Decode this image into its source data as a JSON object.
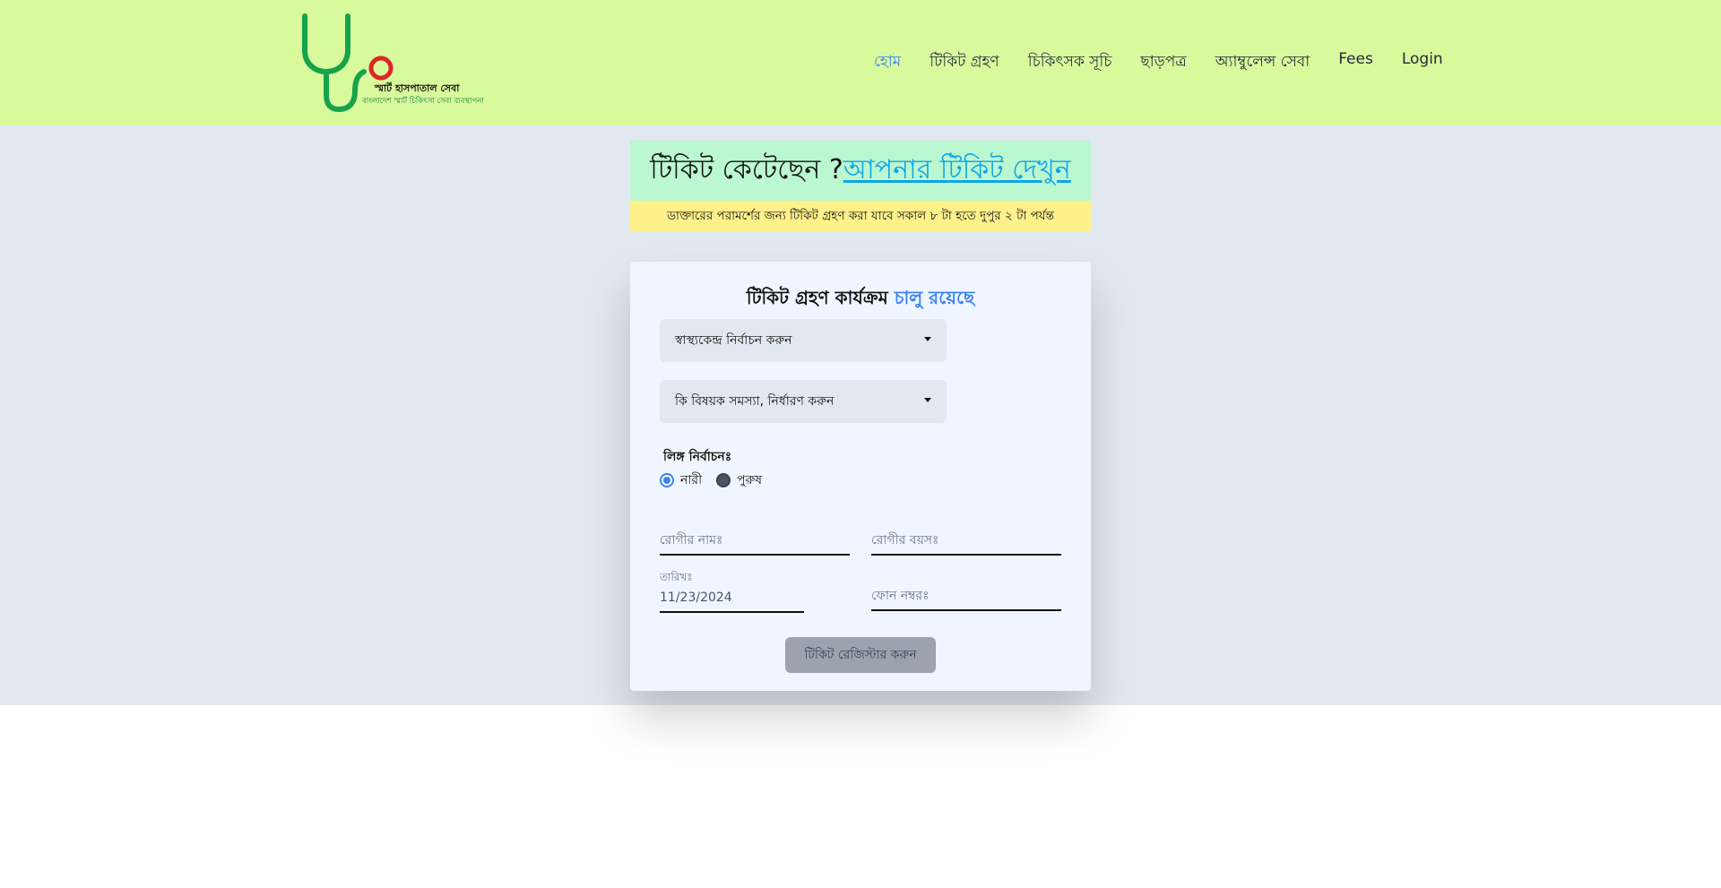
{
  "brand": {
    "name": "স্মার্ট হাসপাতাল সেবা",
    "tagline": "বাংলাদেশ স্মার্ট চিকিৎসা সেবা ব্যবস্থাপনা"
  },
  "nav": {
    "items": [
      {
        "label": "হোম",
        "active": true
      },
      {
        "label": "টিকিট গ্রহণ"
      },
      {
        "label": "চিকিৎসক সূচি"
      },
      {
        "label": "ছাড়পত্র"
      },
      {
        "label": "অ্যাম্বুলেন্স সেবা"
      },
      {
        "label": "Fees"
      },
      {
        "label": "Login"
      }
    ]
  },
  "banner": {
    "question": "টিকিট কেটেছেন ?",
    "link": " আপনার টিকিট দেখুন",
    "notice": "ডাক্তারের পরামর্শের জন্য টিকিট গ্রহণ করা যাবে সকাল ৮ টা হতে দুপুর ২ টা পর্যন্ত"
  },
  "form": {
    "title": "টিকিট গ্রহণ কার্যক্রম",
    "status": "চালু রয়েছে",
    "center_select": "স্বাস্থ্যকেন্দ্র নির্বাচন করুন",
    "problem_select": "কি বিষয়ক সমস্যা, নির্ধারণ করুন",
    "gender_label": "লিঙ্গ নির্বাচনঃ",
    "gender_options": [
      {
        "label": "নারী",
        "checked": true
      },
      {
        "label": "পুরুষ",
        "checked": false
      }
    ],
    "name_placeholder": "রোগীর নামঃ",
    "age_placeholder": "রোগীর বয়সঃ",
    "date_label": "তারিখঃ",
    "date_value": "11/23/2024",
    "phone_placeholder": "ফোন নম্বরঃ",
    "submit_label": "টিকিট রেজিস্টার করুন"
  },
  "colors": {
    "header_bg": "#d9f99d",
    "accent": "#3b82f6",
    "logo_green": "#16a34a",
    "logo_red": "#dc2626"
  }
}
